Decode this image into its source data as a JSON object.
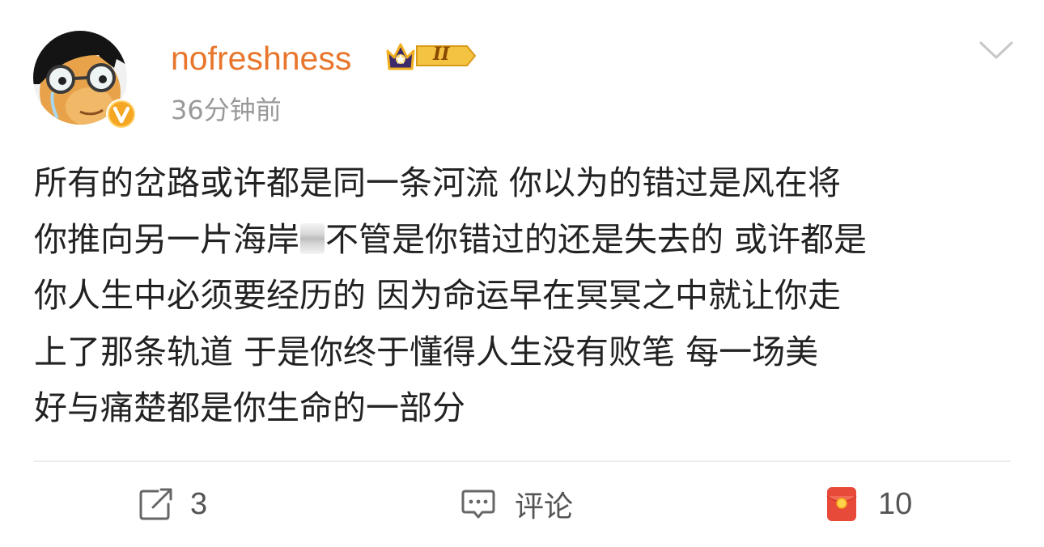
{
  "post": {
    "username": "nofreshness",
    "vip_level": "II",
    "timestamp": "36分钟前",
    "body_lines": [
      "所有的岔路或许都是同一条河流 你以为的错过是风在将",
      "你推向另一片海岸",
      "不管是你错过的还是失去的 或许都是",
      "你人生中必须要经历的 因为命运早在冥冥之中就让你走",
      "上了那条轨道  于是你终于懂得人生没有败笔 每一场美",
      "好与痛楚都是你生命的一部分"
    ]
  },
  "actions": {
    "repost_count": "3",
    "comment_label": "评论",
    "like_count": "10"
  },
  "icons": {
    "avatar": "cartoon-avatar-icon",
    "verified": "verified-badge-icon",
    "vip": "vip-crown-badge-icon",
    "menu": "chevron-down-icon",
    "repost": "repost-icon",
    "comment": "comment-icon",
    "like": "red-envelope-like-icon"
  },
  "colors": {
    "username": "#e8762c",
    "timestamp": "#999999",
    "body_text": "#222222",
    "action_text": "#555555",
    "divider": "#ededed",
    "verified_badge": "#f5a623",
    "like_icon": "#e84a3a"
  }
}
